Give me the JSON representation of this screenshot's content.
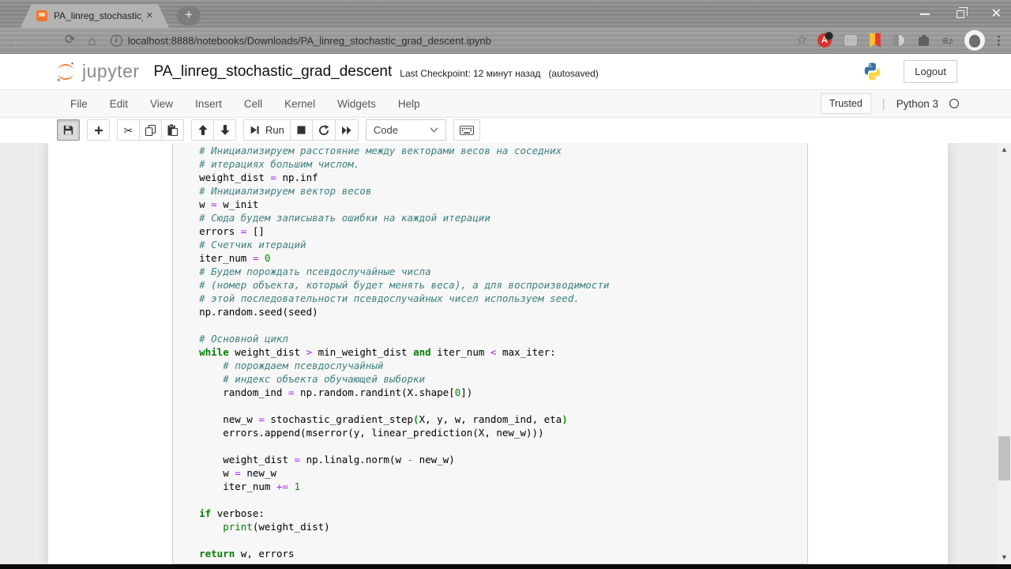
{
  "browser": {
    "tab_title": "PA_linreg_stochastic_grad_descen",
    "url": "localhost:8888/notebooks/Downloads/PA_linreg_stochastic_grad_descent.ipynb"
  },
  "header": {
    "logo_text": "jupyter",
    "title": "PA_linreg_stochastic_grad_descent",
    "checkpoint": "Last Checkpoint: 12 минут назад",
    "autosaved": "(autosaved)",
    "logout_label": "Logout"
  },
  "menubar": {
    "items": [
      "File",
      "Edit",
      "View",
      "Insert",
      "Cell",
      "Kernel",
      "Widgets",
      "Help"
    ],
    "trusted_label": "Trusted",
    "kernel_name": "Python 3"
  },
  "toolbar": {
    "run_label": "Run",
    "cell_type": "Code"
  },
  "colors": {
    "jupyter_orange": "#f37626",
    "comment": "#408080",
    "keyword": "#008000",
    "operator": "#aa22ff",
    "number": "#008800",
    "cell_background": "#f7f7f7",
    "chrome_frame": "#909090"
  },
  "code": {
    "lines": [
      [
        [
          "com",
          "    # Инициализируем расстояние между векторами весов на соседних"
        ]
      ],
      [
        [
          "com",
          "    # итерациях большим числом."
        ]
      ],
      [
        [
          "p",
          "    weight_dist "
        ],
        [
          "op",
          "="
        ],
        [
          "p",
          " np.inf"
        ]
      ],
      [
        [
          "com",
          "    # Инициализируем вектор весов"
        ]
      ],
      [
        [
          "p",
          "    w "
        ],
        [
          "op",
          "="
        ],
        [
          "p",
          " w_init"
        ]
      ],
      [
        [
          "com",
          "    # Сюда будем записывать ошибки на каждой итерации"
        ]
      ],
      [
        [
          "p",
          "    errors "
        ],
        [
          "op",
          "="
        ],
        [
          "p",
          " []"
        ]
      ],
      [
        [
          "com",
          "    # Счетчик итераций"
        ]
      ],
      [
        [
          "p",
          "    iter_num "
        ],
        [
          "op",
          "="
        ],
        [
          "p",
          " "
        ],
        [
          "num",
          "0"
        ]
      ],
      [
        [
          "com",
          "    # Будем порождать псевдослучайные числа"
        ]
      ],
      [
        [
          "com",
          "    # (номер объекта, который будет менять веса), а для воспроизводимости"
        ]
      ],
      [
        [
          "com",
          "    # этой последовательности псевдослучайных чисел используем seed."
        ]
      ],
      [
        [
          "p",
          "    np.random.seed(seed)"
        ]
      ],
      [],
      [
        [
          "com",
          "    # Основной цикл"
        ]
      ],
      [
        [
          "p",
          "    "
        ],
        [
          "kw",
          "while"
        ],
        [
          "p",
          " weight_dist "
        ],
        [
          "op",
          ">"
        ],
        [
          "p",
          " min_weight_dist "
        ],
        [
          "kw",
          "and"
        ],
        [
          "p",
          " iter_num "
        ],
        [
          "op",
          "<"
        ],
        [
          "p",
          " max_iter:"
        ]
      ],
      [
        [
          "com",
          "        # порождаем псевдослучайный"
        ]
      ],
      [
        [
          "com",
          "        # индекс объекта обучающей выборки"
        ]
      ],
      [
        [
          "p",
          "        random_ind "
        ],
        [
          "op",
          "="
        ],
        [
          "p",
          " np.random.randint(X.shape["
        ],
        [
          "num",
          "0"
        ],
        [
          "p",
          "])"
        ]
      ],
      [],
      [
        [
          "p",
          "        new_w "
        ],
        [
          "op",
          "="
        ],
        [
          "p",
          " stochastic_gradient_step"
        ],
        [
          "mb",
          "("
        ],
        [
          "p",
          "X, y, w, random_ind, eta"
        ],
        [
          "mb",
          ")"
        ]
      ],
      [
        [
          "p",
          "        errors.append(mserror(y, linear_prediction(X, new_w)))"
        ]
      ],
      [],
      [
        [
          "p",
          "        weight_dist "
        ],
        [
          "op",
          "="
        ],
        [
          "p",
          " np.linalg.norm(w "
        ],
        [
          "op",
          "-"
        ],
        [
          "p",
          " new_w)"
        ]
      ],
      [
        [
          "p",
          "        w "
        ],
        [
          "op",
          "="
        ],
        [
          "p",
          " new_w"
        ]
      ],
      [
        [
          "p",
          "        iter_num "
        ],
        [
          "op",
          "+="
        ],
        [
          "p",
          " "
        ],
        [
          "num",
          "1"
        ]
      ],
      [],
      [
        [
          "p",
          "    "
        ],
        [
          "kw",
          "if"
        ],
        [
          "p",
          " verbose:"
        ]
      ],
      [
        [
          "p",
          "        "
        ],
        [
          "bi",
          "print"
        ],
        [
          "p",
          "(weight_dist)"
        ]
      ],
      [],
      [
        [
          "p",
          "    "
        ],
        [
          "kw",
          "return"
        ],
        [
          "p",
          " w, errors"
        ]
      ]
    ]
  }
}
